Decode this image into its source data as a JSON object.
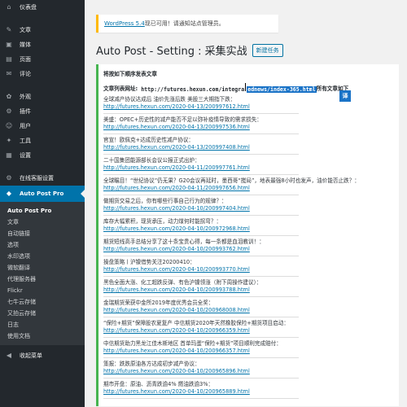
{
  "sidebar": {
    "top": [
      {
        "icon": "⌂",
        "icon_name": "dashboard-icon",
        "label": "仪表盘"
      }
    ],
    "items": [
      {
        "icon": "✎",
        "icon_name": "posts-icon",
        "label": "文章"
      },
      {
        "icon": "▣",
        "icon_name": "media-icon",
        "label": "媒体"
      },
      {
        "icon": "▤",
        "icon_name": "pages-icon",
        "label": "页面"
      },
      {
        "icon": "✉",
        "icon_name": "comments-icon",
        "label": "评论"
      }
    ],
    "items2": [
      {
        "icon": "✿",
        "icon_name": "appearance-icon",
        "label": "外观"
      },
      {
        "icon": "⚙",
        "icon_name": "plugins-icon",
        "label": "插件"
      },
      {
        "icon": "☺",
        "icon_name": "users-icon",
        "label": "用户"
      },
      {
        "icon": "✦",
        "icon_name": "tools-icon",
        "label": "工具"
      },
      {
        "icon": "▦",
        "icon_name": "settings-icon",
        "label": "设置"
      }
    ],
    "online_client": {
      "icon": "⚙",
      "icon_name": "online-client-icon",
      "label": "在线客服设置"
    },
    "current": {
      "icon": "◆",
      "icon_name": "auto-post-pro-icon",
      "label": "Auto Post Pro"
    },
    "submenu": [
      "Auto Post Pro",
      "文章",
      "自动链接",
      "选项",
      "水印选项",
      "微软翻译",
      "代理服务器",
      "Flickr",
      "七牛云存储",
      "又拍云存储",
      "日志",
      "使用文档"
    ],
    "collapse": {
      "icon": "◀",
      "icon_name": "collapse-icon",
      "label": "收起菜单"
    }
  },
  "notice": {
    "link": "WordPress 5.4",
    "text": "现已可用！请通知站点管理员。"
  },
  "page": {
    "title": "Auto Post - Setting : 采集实战",
    "add_button": "新建任务"
  },
  "panel": {
    "head": "将按如下顺序发表文章",
    "list_url_label": "文章列表网址:",
    "url_before": "http://futures.hexun.com/integra",
    "url_selected": "ednews/index-365.html",
    "url_after": " 所有文章如下",
    "translate_btn": "译"
  },
  "articles": [
    {
      "title": "全球减产协议达成后 油价先涨后跌 美股三大期指下跌：",
      "url": "http://futures.hexun.com/2020-04-13/200997612.html"
    },
    {
      "title": "美盛：OPEC+历史性的减产能否不足以弥补疫情导致的需求损失：",
      "url": "http://futures.hexun.com/2020-04-13/200997536.html"
    },
    {
      "title": "官宣！欧佩克+达成历史性减产协议：",
      "url": "http://futures.hexun.com/2020-04-13/200997408.html"
    },
    {
      "title": "二十国集团能源部长会议公报正式出炉：",
      "url": "http://futures.hexun.com/2020-04-11/200997761.html"
    },
    {
      "title": "全球瞩目！“世纪协议”仍无果？G20会议再延时，墨西哥“搅局”，地表最强8小时也发声，油价能否止跌？：",
      "url": "http://futures.hexun.com/2020-04-11/200997656.html"
    },
    {
      "title": "做期货交易之后，你有哪些行事自己行为的规律？：",
      "url": "http://futures.hexun.com/2020-04-10/200997404.html"
    },
    {
      "title": "库存大幅累积，现货承压，动力煤何时能拐弯？：",
      "url": "http://futures.hexun.com/2020-04-10/200972968.html"
    },
    {
      "title": "期货短线高手总结分享了这十条宝贵心得，每一条都是血泪教训！：",
      "url": "http://futures.hexun.com/2020-04-10/200993762.html"
    },
    {
      "title": "操盘策略丨沪镍借势关注20200410：",
      "url": "http://futures.hexun.com/2020-04-10/200993770.html"
    },
    {
      "title": "黑色全面大涨、化工超跌反弹、有色沪镍领涨（附下周操作建议）：",
      "url": "http://futures.hexun.com/2020-04-10/200993788.html"
    },
    {
      "title": "金瑞期货荣获中金所2019年度优秀会员全奖：",
      "url": "http://futures.hexun.com/2020-04-10/200968008.html"
    },
    {
      "title": "“保险+期货”保障股农夏复产 中信期货2020年天然橡胶保险+期货项目启动：",
      "url": "http://futures.hexun.com/2020-04-10/200966359.html"
    },
    {
      "title": "中信期货助力黑龙江佳木斯地区 首单玛蛋“保险+期货”项目顺利完成赔付：",
      "url": "http://futures.hexun.com/2020-04-10/200966357.html"
    },
    {
      "title": "策报：跌跌原油各方达成初步减产协议：",
      "url": "http://futures.hexun.com/2020-04-10/200965896.html"
    },
    {
      "title": "期市开盘：原油、沥青跌逾4% 燃油跌逾3%：",
      "url": "http://futures.hexun.com/2020-04-10/200965889.html"
    }
  ]
}
